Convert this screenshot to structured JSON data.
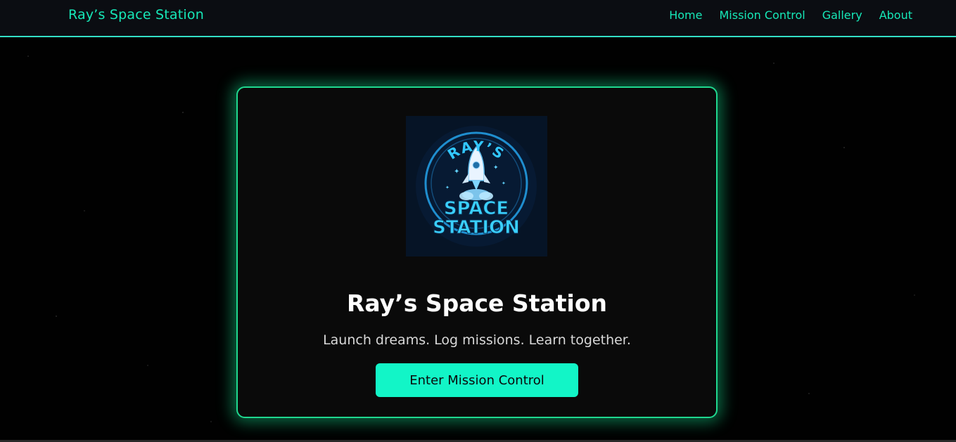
{
  "nav": {
    "brand": "Ray’s Space Station",
    "links": [
      "Home",
      "Mission Control",
      "Gallery",
      "About"
    ]
  },
  "hero": {
    "logo": {
      "top_text": "RAY’S",
      "line1": "SPACE",
      "line2": "STATION"
    },
    "title": "Ray’s Space Station",
    "tagline": "Launch dreams. Log missions. Learn together.",
    "cta_label": "Enter Mission Control"
  },
  "colors": {
    "accent": "#16e8b8",
    "button": "#12f5c7",
    "card_border": "#1fd88f",
    "background": "#010101"
  }
}
